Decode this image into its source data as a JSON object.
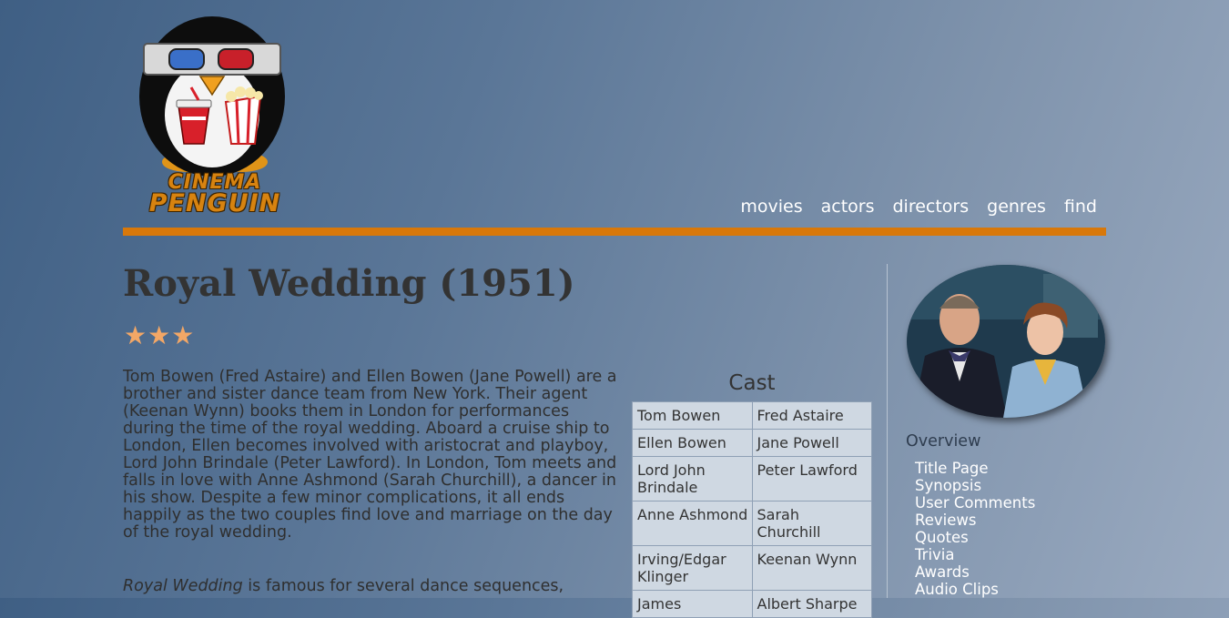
{
  "nav": {
    "items": [
      "movies",
      "actors",
      "directors",
      "genres",
      "find"
    ]
  },
  "logo": {
    "line1": "CINEMA",
    "line2": "PENGUIN"
  },
  "movie": {
    "title": "Royal Wedding (1951)",
    "rating_stars": 3,
    "rating_display": "★★★",
    "synopsis": "Tom Bowen (Fred Astaire) and Ellen Bowen (Jane Powell) are a brother and sister dance team from New York. Their agent (Keenan Wynn) books them in London for performances during the time of the royal wedding. Aboard a cruise ship to London, Ellen becomes involved with aristocrat and playboy, Lord John Brindale (Peter Lawford). In London, Tom meets and falls in love with Anne Ashmond (Sarah Churchill), a dancer in his show. Despite a few minor complications, it all ends happily as the two couples find love and marriage on the day of the royal wedding.",
    "synopsis2_italic": "Royal Wedding",
    "synopsis2_rest": " is famous for several dance sequences,"
  },
  "cast": {
    "heading": "Cast",
    "rows": [
      {
        "role": "Tom Bowen",
        "actor": "Fred Astaire"
      },
      {
        "role": "Ellen Bowen",
        "actor": "Jane Powell"
      },
      {
        "role": "Lord John Brindale",
        "actor": "Peter Lawford"
      },
      {
        "role": "Anne Ashmond",
        "actor": "Sarah Churchill"
      },
      {
        "role": "Irving/Edgar Klinger",
        "actor": "Keenan Wynn"
      },
      {
        "role": "James",
        "actor": "Albert Sharpe"
      }
    ]
  },
  "sidebar": {
    "heading": "Overview",
    "links": [
      "Title Page",
      "Synopsis",
      "User Comments",
      "Reviews",
      "Quotes",
      "Trivia",
      "Awards",
      "Audio Clips"
    ]
  },
  "colors": {
    "accent_bar": "#d8780a",
    "stars": "#f3a766",
    "title_text": "#333333",
    "nav_text": "#ffffff"
  }
}
